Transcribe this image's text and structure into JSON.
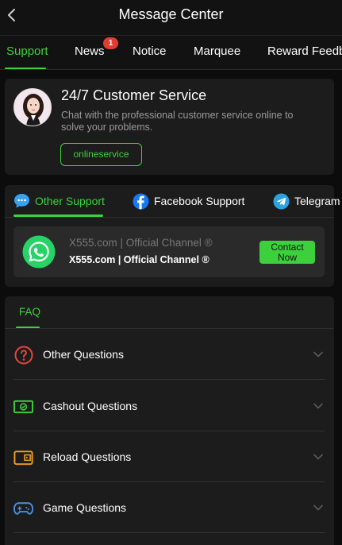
{
  "header": {
    "title": "Message Center"
  },
  "tabs": [
    {
      "label": "Support",
      "active": true
    },
    {
      "label": "News",
      "badge": "1"
    },
    {
      "label": "Notice"
    },
    {
      "label": "Marquee"
    },
    {
      "label": "Reward Feedb"
    }
  ],
  "customer_service": {
    "title": "24/7 Customer Service",
    "description": "Chat with the professional customer service online to solve your problems.",
    "button_label": "onlineservice"
  },
  "support_tabs": [
    {
      "label": "Other Support",
      "icon": "chat-bubble-icon",
      "active": true
    },
    {
      "label": "Facebook Support",
      "icon": "facebook-icon"
    },
    {
      "label": "Telegram",
      "icon": "telegram-icon"
    }
  ],
  "channel": {
    "name": "X555.com | Official Channel ®",
    "subname": "X555.com | Official Channel ®",
    "icon": "whatsapp-icon",
    "button_label": "Contact Now"
  },
  "faq": {
    "tab_label": "FAQ",
    "items": [
      {
        "label": "Other Questions",
        "icon": "question-circle-icon",
        "color": "#e8453c"
      },
      {
        "label": "Cashout Questions",
        "icon": "cash-icon",
        "color": "#3cd13c"
      },
      {
        "label": "Reload Questions",
        "icon": "wallet-icon",
        "color": "#f0a020"
      },
      {
        "label": "Game Questions",
        "icon": "gamepad-icon",
        "color": "#4a90e2"
      }
    ]
  },
  "colors": {
    "accent": "#3cd13c",
    "background": "#0c0c0c",
    "card": "#1c1c1c",
    "badge": "#e43b2f"
  }
}
